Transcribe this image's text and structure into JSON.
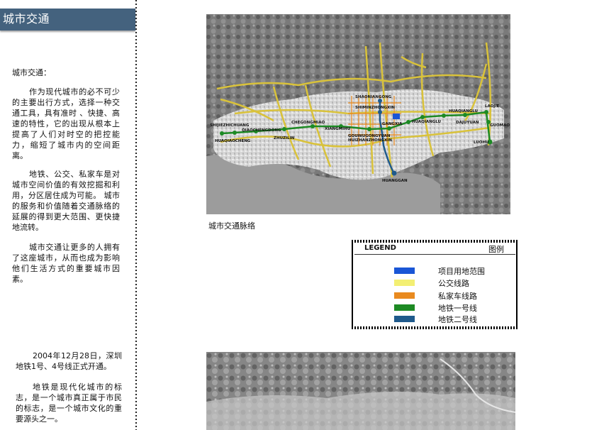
{
  "header": {
    "title": "城市交通"
  },
  "sidebar": {
    "heading": "城市交通：",
    "paragraphs": [
      "作为现代城市的必不可少的主要出行方式，选择一种交通工具，具有准时 、快捷、高速的特性，它的出现从根本上提高了人们对时空的把控能力，缩短了城市内的空间距离。",
      "地铁、公交、私家车是对城市空间价值的有效挖掘和利用，分区居住成为可能。 城市的服务和价值随着交通脉络的延展的得到更大范围、更快捷地流转。",
      "城市交通让更多的人拥有了这座城市，从而也成为影响他们生活方式的重要城市因素。"
    ],
    "bottom_paragraphs": [
      "2004年12月28日，深圳地铁1号、4号线正式开通。",
      "地铁是现代化城市的标志，是一个城市真正属于市民的标志，是一个城市文化的重要源头之一。"
    ]
  },
  "map": {
    "caption": "城市交通脉络",
    "station_labels": [
      "SHAONIANGONG",
      "SHIMINZHONGXIN",
      "HUAQIANGLU",
      "LAOJIE",
      "SHIJIEZHICHUANG",
      "QIAOCHENGDONG",
      "CHEGONGMIAO",
      "XIANGMIHU",
      "GANGXIA",
      "HUAQIANGLU",
      "DAJUYUAN",
      "GUOMAO",
      "HUAQIAOCHENG",
      "ZHUZILIN",
      "GOUWUGONGYUAN",
      "HUIZHANZHONGXIN",
      "LUOHU",
      "HUANGGAN"
    ]
  },
  "legend": {
    "title_en": "LEGEND",
    "title_zh": "图例",
    "items": [
      {
        "label": "项目用地范围",
        "color": "#1a56d6"
      },
      {
        "label": "公交线路",
        "color": "#f3ef73"
      },
      {
        "label": "私家车线路",
        "color": "#e98a1f"
      },
      {
        "label": "地铁一号线",
        "color": "#1d8a24"
      },
      {
        "label": "地铁二号线",
        "color": "#1f5a8c"
      }
    ]
  }
}
